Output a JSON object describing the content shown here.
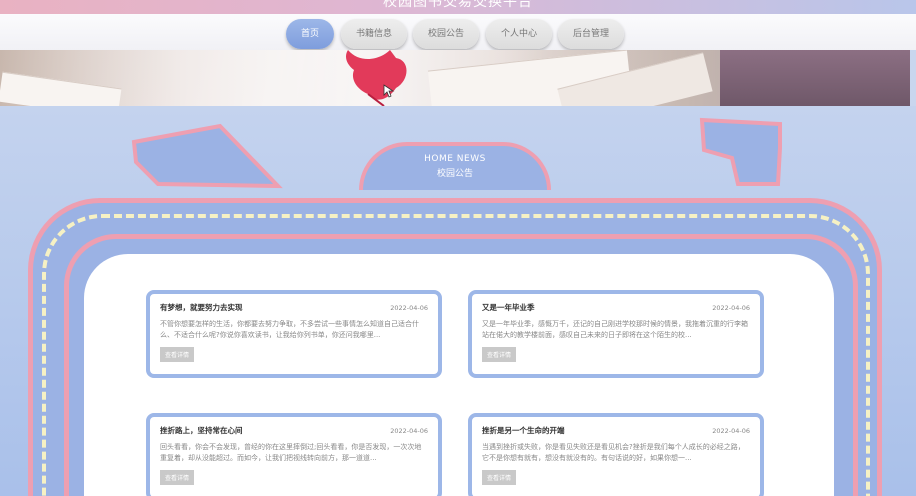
{
  "site": {
    "title": "校园图书交易交换平台"
  },
  "nav": {
    "items": [
      {
        "label": "首页",
        "active": true
      },
      {
        "label": "书籍信息",
        "active": false
      },
      {
        "label": "校园公告",
        "active": false
      },
      {
        "label": "个人中心",
        "active": false
      },
      {
        "label": "后台管理",
        "active": false
      }
    ]
  },
  "section": {
    "title_en": "HOME NEWS",
    "title_zh": "校园公告"
  },
  "news": [
    {
      "title": "有梦想，就要努力去实现",
      "date": "2022-04-06",
      "summary": "不管你想要怎样的生活，你都要去努力争取，不多尝试一些事情怎么知道自己适合什么、不适合什么呢?你说你喜欢读书，让我给你列书单，你还问我哪里...",
      "button": "查看详情"
    },
    {
      "title": "又是一年毕业季",
      "date": "2022-04-06",
      "summary": "又是一年毕业季，感慨万千，还记的自己刚进学校那时候的情景，我拖着沉重的行李箱站在偌大的教学楼前面，感叹自己未来的日子即将在这个陌生的校...",
      "button": "查看详情"
    },
    {
      "title": "挫折路上，坚持常在心间",
      "date": "2022-04-06",
      "summary": "回头看看，你会不会发现，曾经的你在这里摔倒过;回头看看，你是否发现，一次次地重复着，却从没能超过。而如今，让我们把视线转向前方，那一道道...",
      "button": "查看详情"
    },
    {
      "title": "挫折是另一个生命的开端",
      "date": "2022-04-06",
      "summary": "当遇到挫折或失败，你是看见失败还是看见机会?挫折是我们每个人成长的必经之路，它不是你想有就有，想没有就没有的。有句话说的好，如果你想一...",
      "button": "查看详情"
    }
  ],
  "colors": {
    "accent_blue": "#9db7e8",
    "accent_pink": "#ee9fb1",
    "dash_cream": "#f6f1c4"
  }
}
